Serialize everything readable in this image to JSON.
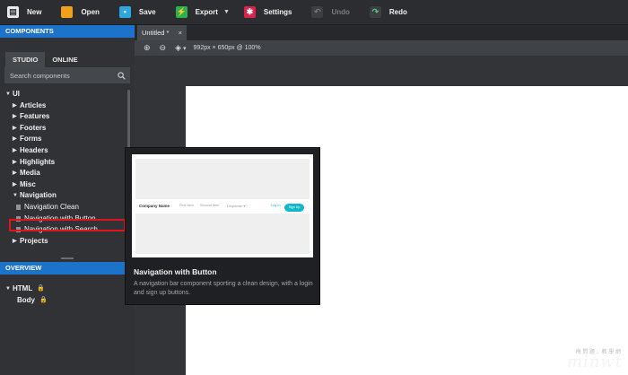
{
  "toolbar": {
    "new_label": "New",
    "open_label": "Open",
    "save_label": "Save",
    "export_label": "Export",
    "settings_label": "Settings",
    "undo_label": "Undo",
    "redo_label": "Redo"
  },
  "sidebar": {
    "components_header": "COMPONENTS",
    "tabs": [
      "STUDIO",
      "ONLINE"
    ],
    "search_placeholder": "Search components",
    "root": "UI",
    "categories": [
      "Articles",
      "Features",
      "Footers",
      "Forms",
      "Headers",
      "Highlights",
      "Media",
      "Misc"
    ],
    "navigation": "Navigation",
    "nav_items": [
      "Navigation Clean",
      "Navigation with Button",
      "Navigation with Search"
    ],
    "projects": "Projects",
    "overview_header": "OVERVIEW",
    "overview_items": [
      "HTML",
      "Body"
    ]
  },
  "document": {
    "tab_label": "Untitled *",
    "size_info": "992px × 650px @ 100%"
  },
  "tooltip": {
    "title": "Navigation with Button",
    "description": "A navigation bar component sporting a clean design, with a login and sign up buttons.",
    "preview": {
      "brand": "Company Name",
      "first": "First Item",
      "second": "Second Item",
      "dropdown": "Dropdown ▾",
      "login": "Log In",
      "signup": "Sign Up"
    }
  },
  "watermark": {
    "text": "minwt",
    "sub": "梅 問 題 ．教 學 網"
  },
  "colors": {
    "accent": "#1d72c9",
    "highlight_box": "#e0141c",
    "signup_button": "#12b8c9"
  }
}
